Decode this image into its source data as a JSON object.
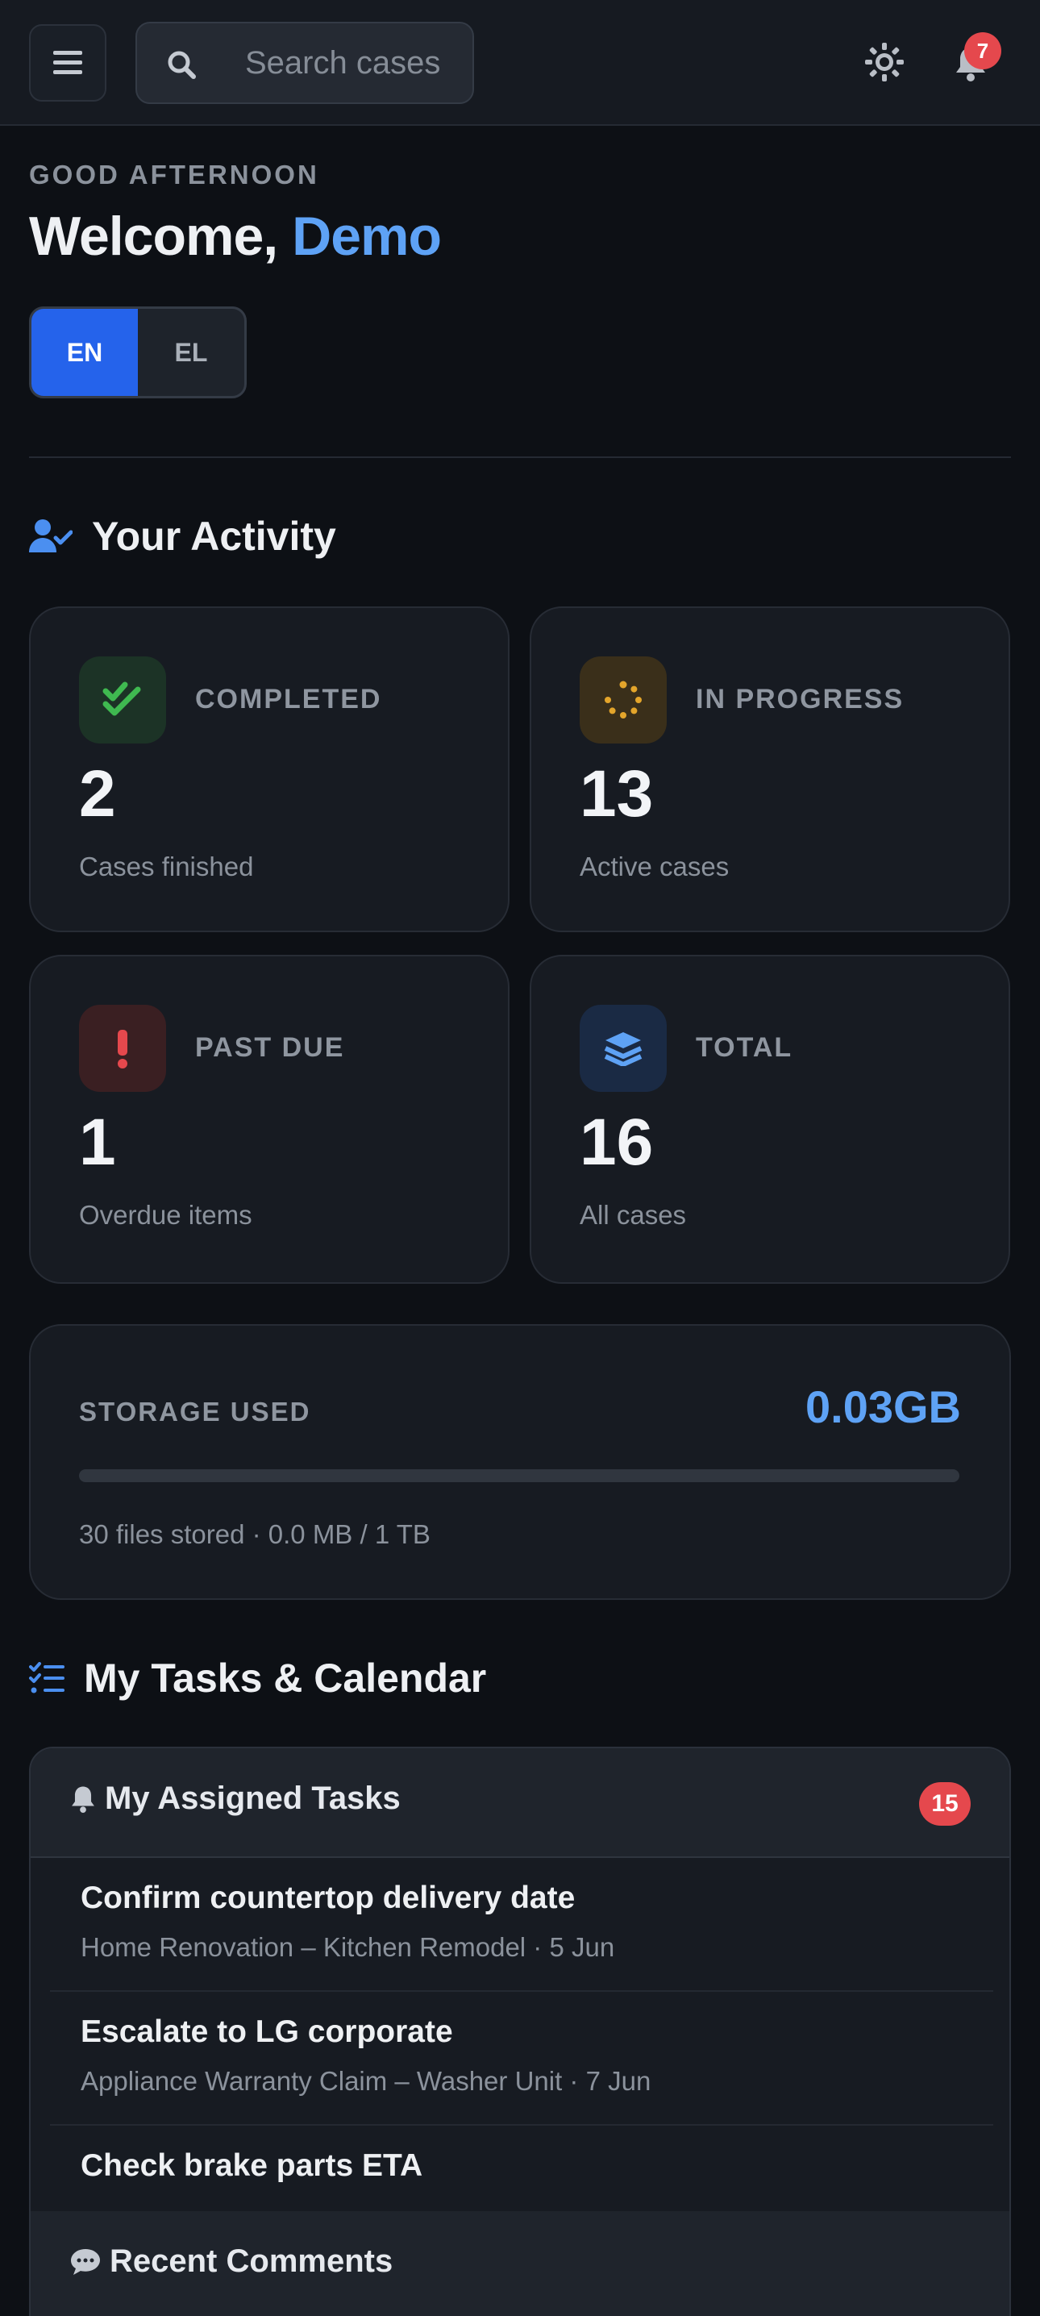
{
  "header": {
    "search_placeholder": "Search cases",
    "notification_count": "7"
  },
  "greeting": {
    "eyebrow": "GOOD AFTERNOON",
    "welcome_prefix": "Welcome,",
    "user_name": "Demo"
  },
  "language": {
    "options": [
      "EN",
      "EL"
    ],
    "selected": "EN"
  },
  "activity": {
    "title": "Your Activity",
    "stats": [
      {
        "label": "COMPLETED",
        "value": "2",
        "sub": "Cases finished",
        "icon": "check-double-icon",
        "color": "#3fb950"
      },
      {
        "label": "IN PROGRESS",
        "value": "13",
        "sub": "Active cases",
        "icon": "spinner-icon",
        "color": "#e3a52b"
      },
      {
        "label": "PAST DUE",
        "value": "1",
        "sub": "Overdue items",
        "icon": "exclamation-icon",
        "color": "#e5484d"
      },
      {
        "label": "TOTAL",
        "value": "16",
        "sub": "All cases",
        "icon": "layers-icon",
        "color": "#5ea2f5"
      }
    ]
  },
  "storage": {
    "label": "STORAGE USED",
    "value": "0.03GB",
    "used_fraction": 0,
    "sub": "30 files stored · 0.0 MB / 1 TB"
  },
  "tasks_section": {
    "title": "My Tasks & Calendar",
    "assigned": {
      "title": "My Assigned Tasks",
      "count": "15",
      "items": [
        {
          "title": "Confirm countertop delivery date",
          "meta": "Home Renovation – Kitchen Remodel · 5 Jun"
        },
        {
          "title": "Escalate to LG corporate",
          "meta": "Appliance Warranty Claim – Washer Unit · 7 Jun"
        },
        {
          "title": "Check brake parts ETA",
          "meta": ""
        }
      ]
    },
    "comments_title": "Recent Comments"
  },
  "colors": {
    "accent": "#5ea2f5",
    "primary_button": "#2563eb",
    "badge": "#e5484d"
  }
}
